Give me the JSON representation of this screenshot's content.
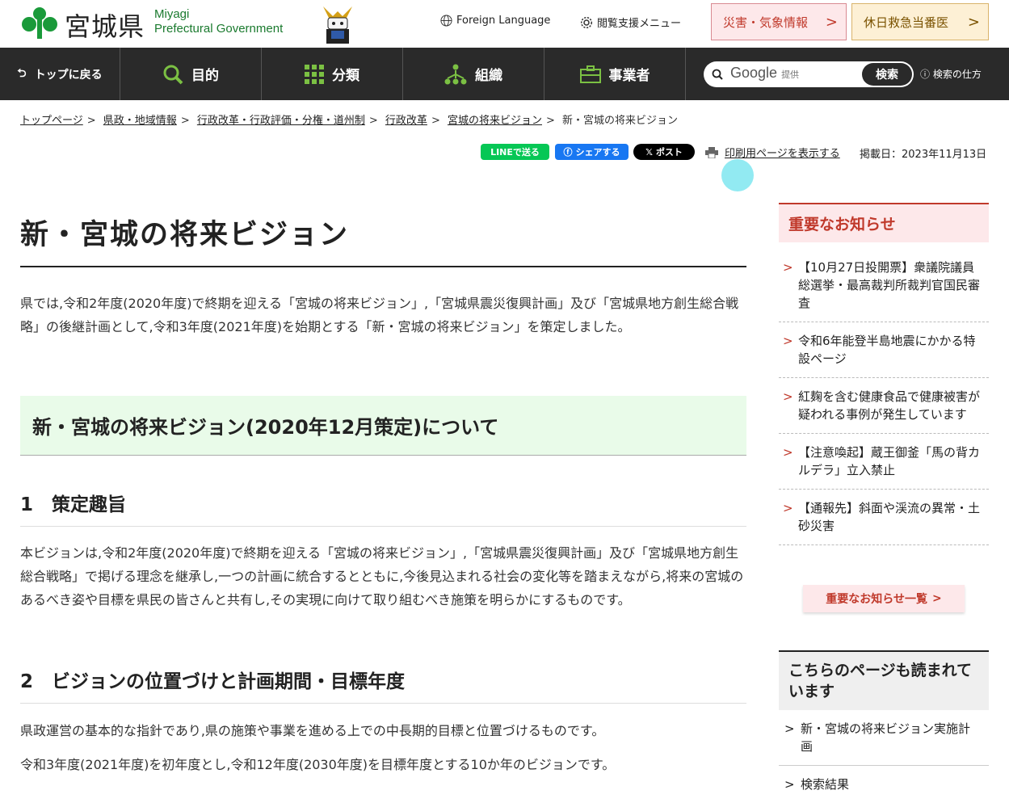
{
  "header": {
    "logo_jp": "宮城県",
    "logo_en_1": "Miyagi",
    "logo_en_2": "Prefectural Government",
    "foreign_language": "Foreign Language",
    "accessibility_menu": "閲覧支援メニュー",
    "disaster_info": "災害・気象情報",
    "holiday_emergency": "休日救急当番医"
  },
  "nav": {
    "back_top": "トップに戻る",
    "purpose": "目的",
    "category": "分類",
    "organization": "組織",
    "business": "事業者",
    "search_provider": "Google",
    "search_provided": "提供",
    "search_button": "検索",
    "search_howto": "検索の仕方"
  },
  "breadcrumb": {
    "items": [
      "トップページ",
      "県政・地域情報",
      "行政改革・行政評価・分権・道州制",
      "行政改革",
      "宮城の将来ビジョン"
    ],
    "current": "新・宮城の将来ビジョン"
  },
  "share": {
    "line": "LINEで送る",
    "facebook": "シェアする",
    "x": "ポスト",
    "print": "印刷用ページを表示する",
    "published": "掲載日：2023年11月13日"
  },
  "main": {
    "title": "新・宮城の将来ビジョン",
    "intro": "県では,令和2年度(2020年度)で終期を迎える「宮城の将来ビジョン」,「宮城県震災復興計画」及び「宮城県地方創生総合戦略」の後継計画として,令和3年度(2021年度)を始期とする「新・宮城の将来ビジョン」を策定しました。",
    "section_heading": "新・宮城の将来ビジョン(2020年12月策定)について",
    "sec1_title": "1　策定趣旨",
    "sec1_body": "本ビジョンは,令和2年度(2020年度)で終期を迎える「宮城の将来ビジョン」,「宮城県震災復興計画」及び「宮城県地方創生総合戦略」で掲げる理念を継承し,一つの計画に統合するとともに,今後見込まれる社会の変化等を踏まえながら,将来の宮城のあるべき姿や目標を県民の皆さんと共有し,その実現に向けて取り組むべき施策を明らかにするものです。",
    "sec2_title": "2　ビジョンの位置づけと計画期間・目標年度",
    "sec2_body1": "県政運営の基本的な指針であり,県の施策や事業を進める上での中長期的目標と位置づけるものです。",
    "sec2_body2": "令和3年度(2021年度)を初年度とし,令和12年度(2030年度)を目標年度とする10か年のビジョンです。"
  },
  "sidebar": {
    "notice_title": "重要なお知らせ",
    "notices": [
      "【10月27日投開票】衆議院議員総選挙・最高裁判所裁判官国民審査",
      "令和6年能登半島地震にかかる特設ページ",
      "紅麹を含む健康食品で健康被害が疑われる事例が発生しています",
      "【注意喚起】蔵王御釜「馬の背カルデラ」立入禁止",
      "【通報先】斜面や渓流の異常・土砂災害"
    ],
    "notice_more": "重要なお知らせ一覧",
    "read_title": "こちらのページも読まれています",
    "read_items": [
      "新・宮城の将来ビジョン実施計画",
      "検索結果"
    ]
  },
  "colors": {
    "nav_bg": "#2a2a2a",
    "brand_green": "#1a7a2e",
    "notice_red": "#c0392b",
    "heading_bg": "#e9fbe9"
  }
}
